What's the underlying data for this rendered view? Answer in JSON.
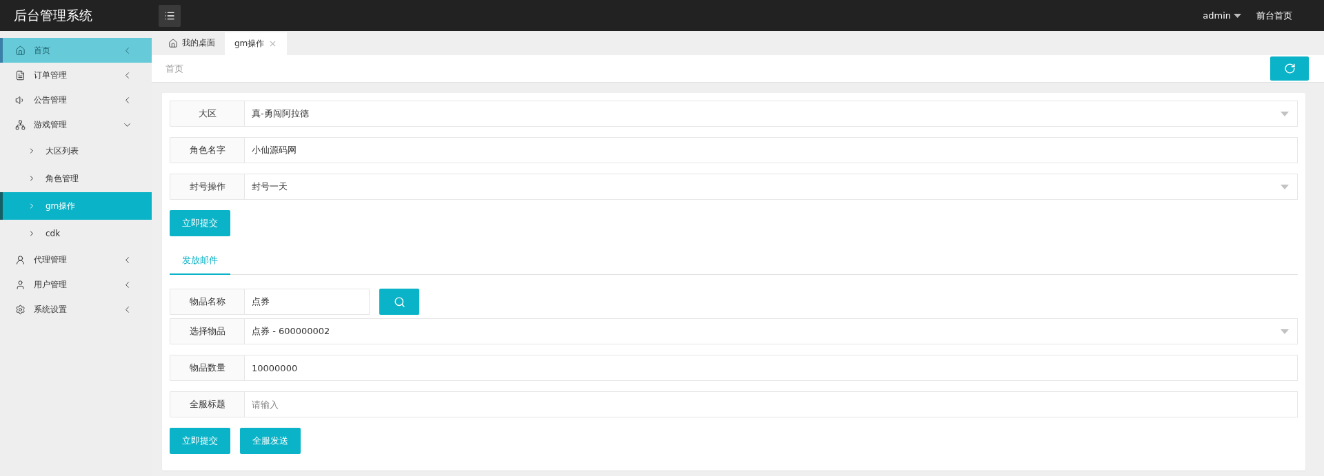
{
  "header": {
    "title": "后台管理系统",
    "user": "admin",
    "front_link": "前台首页"
  },
  "sidebar": {
    "items": [
      {
        "label": "首页",
        "selected": false,
        "hovered": true,
        "expanded": false
      },
      {
        "label": "订单管理",
        "selected": false,
        "hovered": false,
        "expanded": false
      },
      {
        "label": "公告管理",
        "selected": false,
        "hovered": false,
        "expanded": false
      },
      {
        "label": "游戏管理",
        "selected": false,
        "hovered": false,
        "expanded": true,
        "children": [
          {
            "label": "大区列表",
            "selected": false
          },
          {
            "label": "角色管理",
            "selected": false
          },
          {
            "label": "gm操作",
            "selected": true
          },
          {
            "label": "cdk",
            "selected": false
          }
        ]
      },
      {
        "label": "代理管理",
        "selected": false,
        "hovered": false,
        "expanded": false
      },
      {
        "label": "用户管理",
        "selected": false,
        "hovered": false,
        "expanded": false
      },
      {
        "label": "系统设置",
        "selected": false,
        "hovered": false,
        "expanded": false
      }
    ]
  },
  "tabs": [
    {
      "label": "我的桌面",
      "selected": false
    },
    {
      "label": "gm操作",
      "selected": true
    }
  ],
  "breadcrumb": "首页",
  "form": {
    "fields": [
      {
        "kind": "select",
        "label": "大区",
        "value": "真-勇闯阿拉德"
      },
      {
        "kind": "input",
        "label": "角色名字",
        "value": "小仙源码网"
      },
      {
        "kind": "select",
        "label": "封号操作",
        "value": "封号一天"
      }
    ],
    "buttons": [
      "立即提交"
    ]
  },
  "mail_tabs": [
    {
      "label": "发放邮件",
      "selected": true
    }
  ],
  "mail_form": {
    "fields": [
      {
        "kind": "search",
        "label": "物品名称",
        "value": "点券"
      },
      {
        "kind": "select",
        "label": "选择物品",
        "value": "点券 - 600000002"
      },
      {
        "kind": "input",
        "label": "物品数量",
        "value": "10000000"
      },
      {
        "kind": "input",
        "label": "全服标题",
        "placeholder": "请输入"
      }
    ],
    "buttons": [
      "立即提交",
      "全服发送"
    ]
  }
}
